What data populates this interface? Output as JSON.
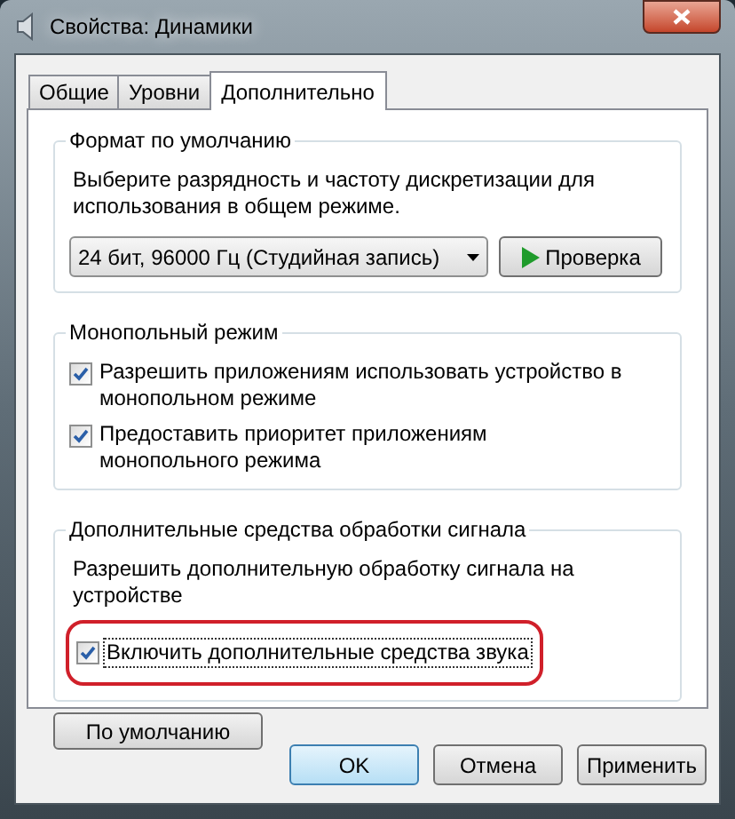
{
  "window": {
    "title": "Свойства: Динамики"
  },
  "tabs": [
    {
      "label": "Общие",
      "selected": false
    },
    {
      "label": "Уровни",
      "selected": false
    },
    {
      "label": "Дополнительно",
      "selected": true
    }
  ],
  "default_format": {
    "title": "Формат по умолчанию",
    "description": "Выберите разрядность и частоту дискретизации для использования в общем режиме.",
    "format_select": {
      "value": "24 бит, 96000 Гц (Студийная запись)"
    },
    "test_button": "Проверка"
  },
  "exclusive_mode": {
    "title": "Монопольный режим",
    "options": [
      {
        "label": "Разрешить приложениям использовать устройство в монопольном режиме",
        "checked": true
      },
      {
        "label": "Предоставить приоритет приложениям монопольного режима",
        "checked": true
      }
    ]
  },
  "enhancements": {
    "title": "Дополнительные средства обработки сигнала",
    "description": "Разрешить дополнительную обработку сигнала на устройстве",
    "options": [
      {
        "label": "Включить дополнительные средства звука",
        "checked": true,
        "highlighted": true
      }
    ]
  },
  "restore_button": "По умолчанию",
  "buttons": [
    {
      "label": "OK",
      "default": true
    },
    {
      "label": "Отмена",
      "default": false
    },
    {
      "label": "Применить",
      "default": false
    }
  ]
}
